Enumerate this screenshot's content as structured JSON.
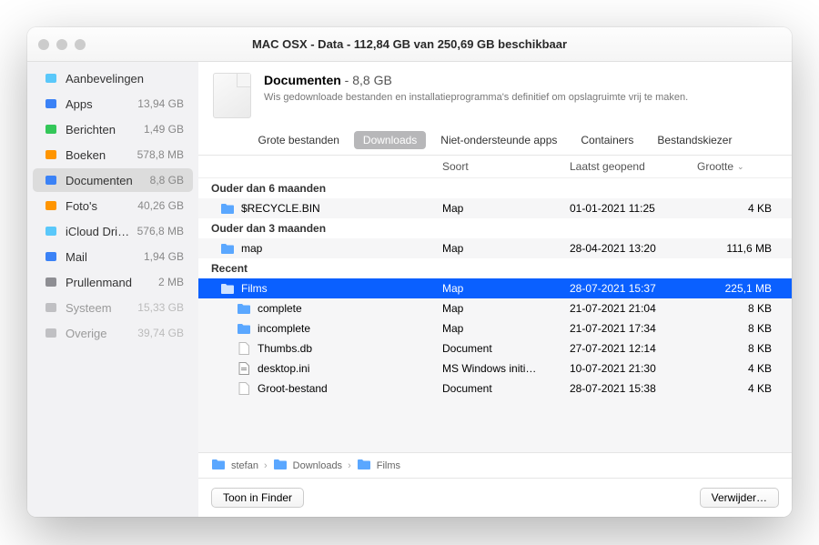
{
  "window_title": "MAC OSX - Data - 112,84 GB van 250,69 GB beschikbaar",
  "sidebar": [
    {
      "icon": "bulb",
      "label": "Aanbevelingen",
      "size": "",
      "color": "#5ac8fa"
    },
    {
      "icon": "app",
      "label": "Apps",
      "size": "13,94 GB",
      "color": "#3b82f6"
    },
    {
      "icon": "chat",
      "label": "Berichten",
      "size": "1,49 GB",
      "color": "#34c759"
    },
    {
      "icon": "book",
      "label": "Boeken",
      "size": "578,8 MB",
      "color": "#ff9500"
    },
    {
      "icon": "doc",
      "label": "Documenten",
      "size": "8,8 GB",
      "selected": true,
      "color": "#3b82f6"
    },
    {
      "icon": "photo",
      "label": "Foto's",
      "size": "40,26 GB",
      "color": "#ff9500"
    },
    {
      "icon": "cloud",
      "label": "iCloud Drive",
      "size": "576,8 MB",
      "color": "#5ac8fa"
    },
    {
      "icon": "mail",
      "label": "Mail",
      "size": "1,94 GB",
      "color": "#3b82f6"
    },
    {
      "icon": "trash",
      "label": "Prullenmand",
      "size": "2 MB",
      "color": "#8e8e93"
    },
    {
      "icon": "sys",
      "label": "Systeem",
      "size": "15,33 GB",
      "dim": true,
      "color": "#c0c0c3"
    },
    {
      "icon": "oth",
      "label": "Overige",
      "size": "39,74 GB",
      "dim": true,
      "color": "#c0c0c3"
    }
  ],
  "header": {
    "title": "Documenten",
    "size": " - 8,8 GB",
    "desc": "Wis gedownloade bestanden en installatieprogramma's definitief om opslagruimte vrij te maken."
  },
  "tabs": [
    {
      "label": "Grote bestanden"
    },
    {
      "label": "Downloads",
      "active": true
    },
    {
      "label": "Niet-ondersteunde apps"
    },
    {
      "label": "Containers"
    },
    {
      "label": "Bestandskiezer"
    }
  ],
  "columns": {
    "c1": "",
    "c2": "Soort",
    "c3": "Laatst geopend",
    "c4": "Grootte"
  },
  "groups": [
    {
      "label": "Ouder dan 6 maanden",
      "rows": [
        {
          "icon": "folder",
          "name": "$RECYCLE.BIN",
          "kind": "Map",
          "opened": "01-01-2021 11:25",
          "size": "4 KB"
        }
      ]
    },
    {
      "label": "Ouder dan 3 maanden",
      "rows": [
        {
          "icon": "folder",
          "name": "map",
          "kind": "Map",
          "opened": "28-04-2021 13:20",
          "size": "111,6 MB"
        }
      ]
    },
    {
      "label": "Recent",
      "rows": [
        {
          "icon": "folder",
          "name": "Films",
          "kind": "Map",
          "opened": "28-07-2021 15:37",
          "size": "225,1 MB",
          "selected": true
        },
        {
          "icon": "folder",
          "name": "complete",
          "kind": "Map",
          "opened": "21-07-2021 21:04",
          "size": "8 KB",
          "indent": true
        },
        {
          "icon": "folder",
          "name": "incomplete",
          "kind": "Map",
          "opened": "21-07-2021 17:34",
          "size": "8 KB",
          "indent": true
        },
        {
          "icon": "doc",
          "name": "Thumbs.db",
          "kind": "Document",
          "opened": "27-07-2021 12:14",
          "size": "8 KB",
          "indent": true
        },
        {
          "icon": "ini",
          "name": "desktop.ini",
          "kind": "MS Windows initi…",
          "opened": "10-07-2021 21:30",
          "size": "4 KB",
          "indent": true
        },
        {
          "icon": "doc",
          "name": "Groot-bestand",
          "kind": "Document",
          "opened": "28-07-2021 15:38",
          "size": "4 KB",
          "indent": true
        }
      ]
    }
  ],
  "breadcrumb": [
    "stefan",
    "Downloads",
    "Films"
  ],
  "actions": {
    "left": "Toon in Finder",
    "right": "Verwijder…"
  }
}
